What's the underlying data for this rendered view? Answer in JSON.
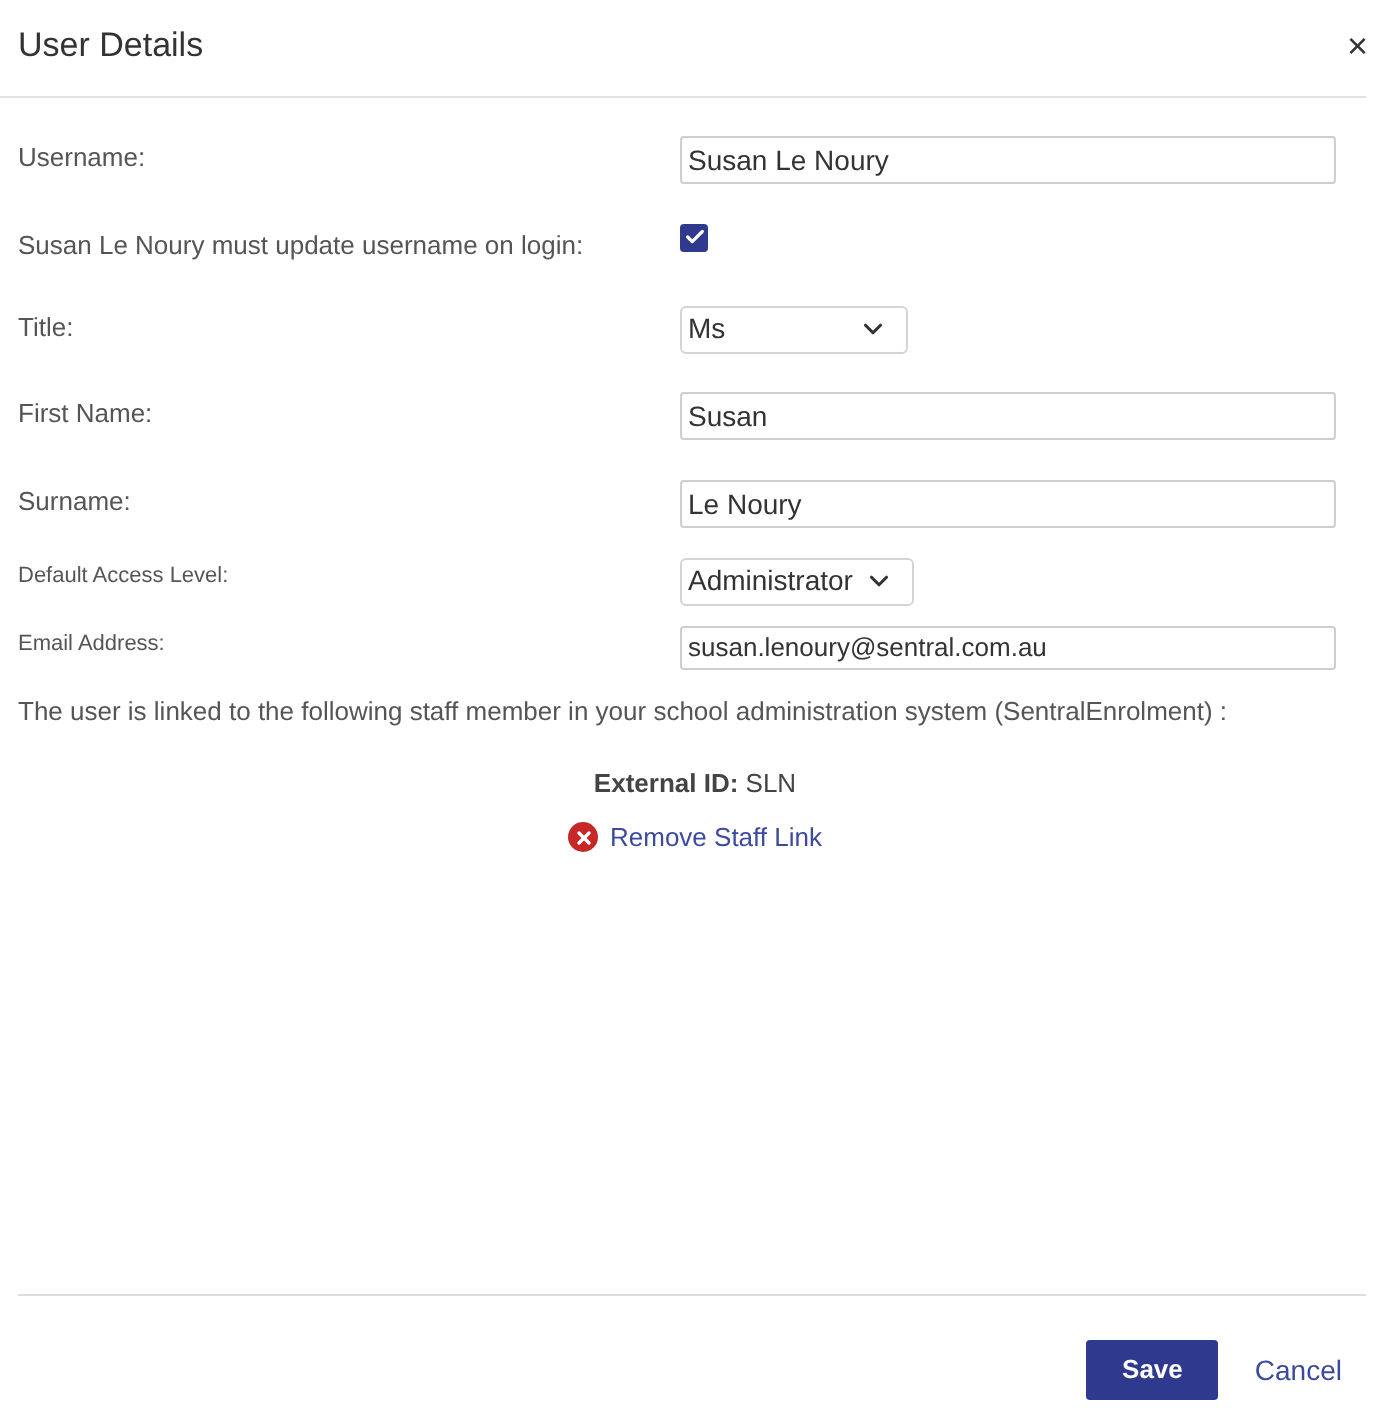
{
  "dialog": {
    "title": "User Details",
    "close": "×"
  },
  "fields": [
    {
      "kind": "text",
      "label": "Username:",
      "value": "Susan Le Noury"
    },
    {
      "kind": "checkbox",
      "label": "Susan Le Noury must update username on login:",
      "checked": true
    },
    {
      "kind": "select",
      "label": "Title:",
      "value": "Ms"
    },
    {
      "kind": "text",
      "label": "First Name:",
      "value": "Susan"
    },
    {
      "kind": "text",
      "label": "Surname:",
      "value": "Le Noury"
    }
  ],
  "access_fields": [
    {
      "kind": "select",
      "label": "Default Access Level:",
      "value": "Administrator"
    },
    {
      "kind": "text",
      "label": "Email Address:",
      "value": "susan.lenoury@sentral.com.au"
    }
  ],
  "link_note": "The user is linked to the following staff member in your school administration system (SentralEnrolment) :",
  "external_id": "**External ID:** SLN",
  "remove_link": "Remove Staff Link",
  "buttons": [
    {
      "kind": "primary",
      "label": "Save"
    },
    {
      "kind": "link",
      "label": "Cancel"
    }
  ]
}
